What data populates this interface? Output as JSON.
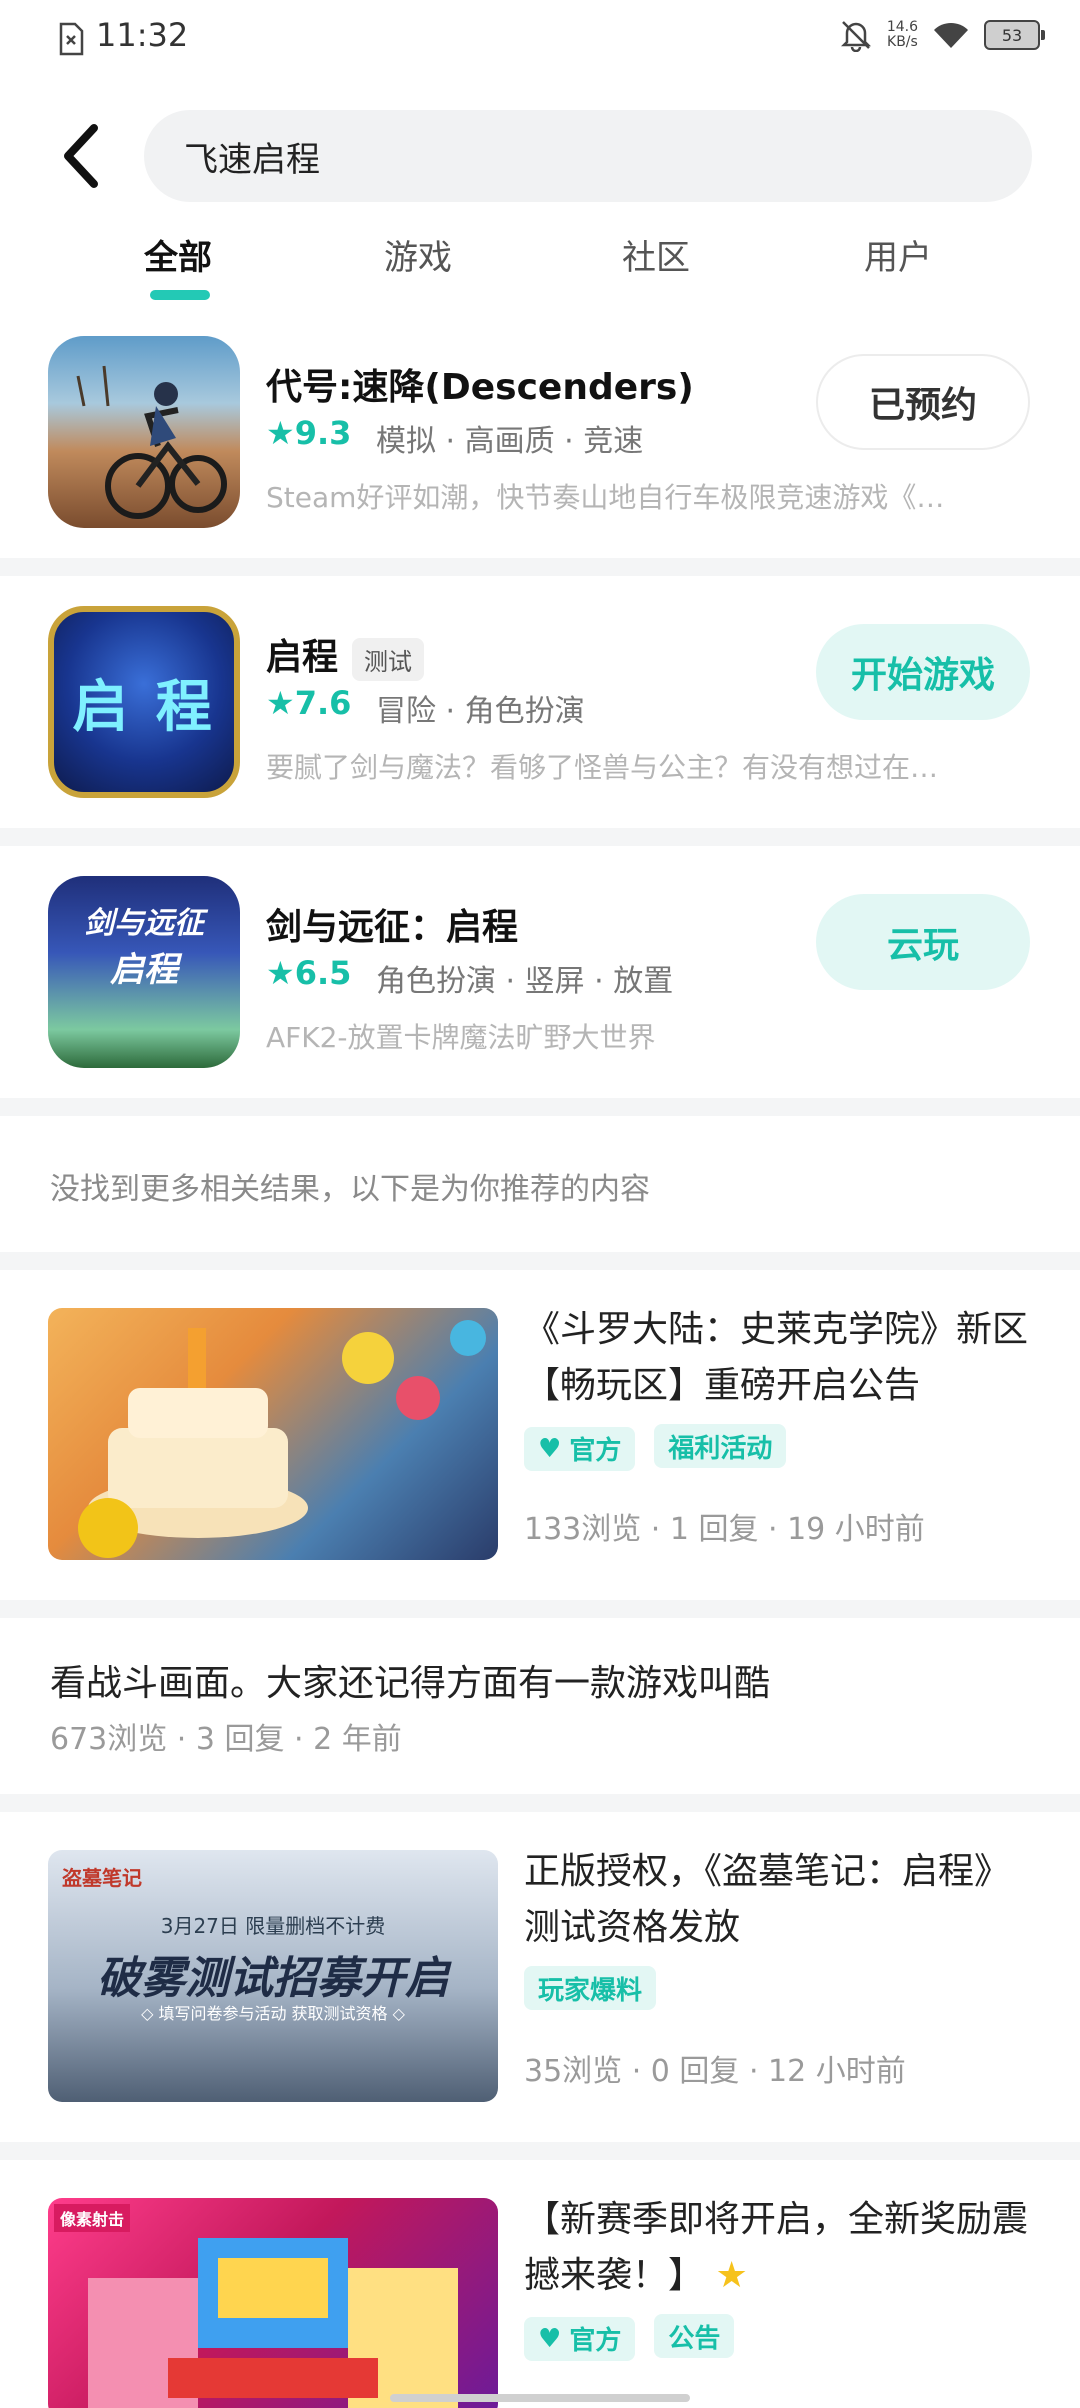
{
  "status": {
    "time": "11:32",
    "net_top": "14.6",
    "net_bottom": "KB/s",
    "battery": "53"
  },
  "search": {
    "query": "飞速启程"
  },
  "tabs": [
    {
      "label": "全部"
    },
    {
      "label": "游戏"
    },
    {
      "label": "社区"
    },
    {
      "label": "用户"
    }
  ],
  "apps": [
    {
      "name": "代号:速降(Descenders)",
      "badge": "",
      "rating": "9.3",
      "tags": "模拟 · 高画质 · 竞速",
      "desc": "Steam好评如潮，快节奏山地自行车极限竞速游戏《…",
      "button": "已预约"
    },
    {
      "name": "启程",
      "badge": "测试",
      "rating": "7.6",
      "tags": "冒险 · 角色扮演",
      "desc": "要腻了剑与魔法？看够了怪兽与公主？有没有想过在…",
      "button": "开始游戏"
    },
    {
      "name": "剑与远征：启程",
      "badge": "",
      "rating": "6.5",
      "tags": "角色扮演 · 竖屏 · 放置",
      "desc": "AFK2-放置卡牌魔法旷野大世界",
      "button": "云玩"
    }
  ],
  "app_icons": [
    {
      "text": ""
    },
    {
      "text": "启 程"
    },
    {
      "text": "剑与远征",
      "sub": "启程"
    }
  ],
  "notice": "没找到更多相关结果，以下是为你推荐的内容",
  "posts": [
    {
      "title": "《斗罗大陆：史莱克学院》新区【畅玩区】重磅开启公告",
      "tags": [
        "官方",
        "福利活动"
      ],
      "meta": "133浏览 · 1 回复 · 19 小时前"
    },
    {
      "title": "看战斗画面。大家还记得方面有一款游戏叫酷",
      "meta": "673浏览 · 3 回复 · 2 年前"
    },
    {
      "title": "正版授权，《盗墓笔记：启程》测试资格发放",
      "tags": [
        "玩家爆料"
      ],
      "meta": "35浏览 · 0 回复 · 12 小时前",
      "thumb_top": "3月27日 限量删档不计费",
      "thumb_main": "破雾测试招募开启",
      "thumb_sub": "◇ 填写问卷参与活动 获取测试资格 ◇",
      "thumb_logo": "盗墓笔记"
    },
    {
      "title": "【新赛季即将开启，全新奖励震撼来袭！】",
      "tags": [
        "官方",
        "公告"
      ],
      "thumb_logo": "像素射击"
    }
  ],
  "colors": {
    "accent": "#17bfa8",
    "accent_bg": "#e2f7f4",
    "separator": "#f4f5f6"
  }
}
